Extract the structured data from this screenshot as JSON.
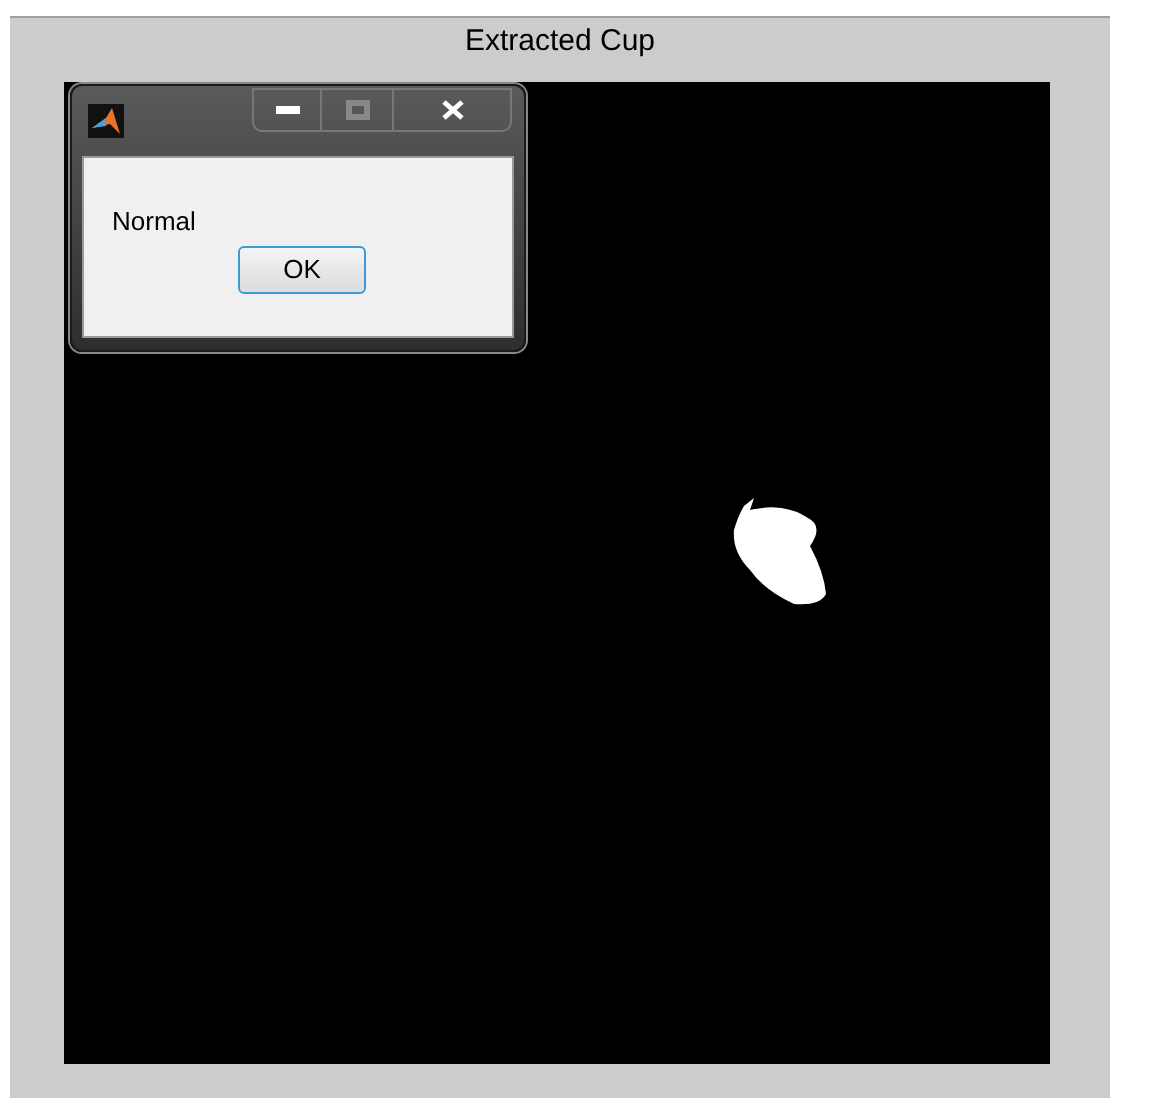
{
  "figure": {
    "title": "Extracted Cup"
  },
  "dialog": {
    "message": "Normal",
    "buttons": [
      "OK"
    ]
  }
}
